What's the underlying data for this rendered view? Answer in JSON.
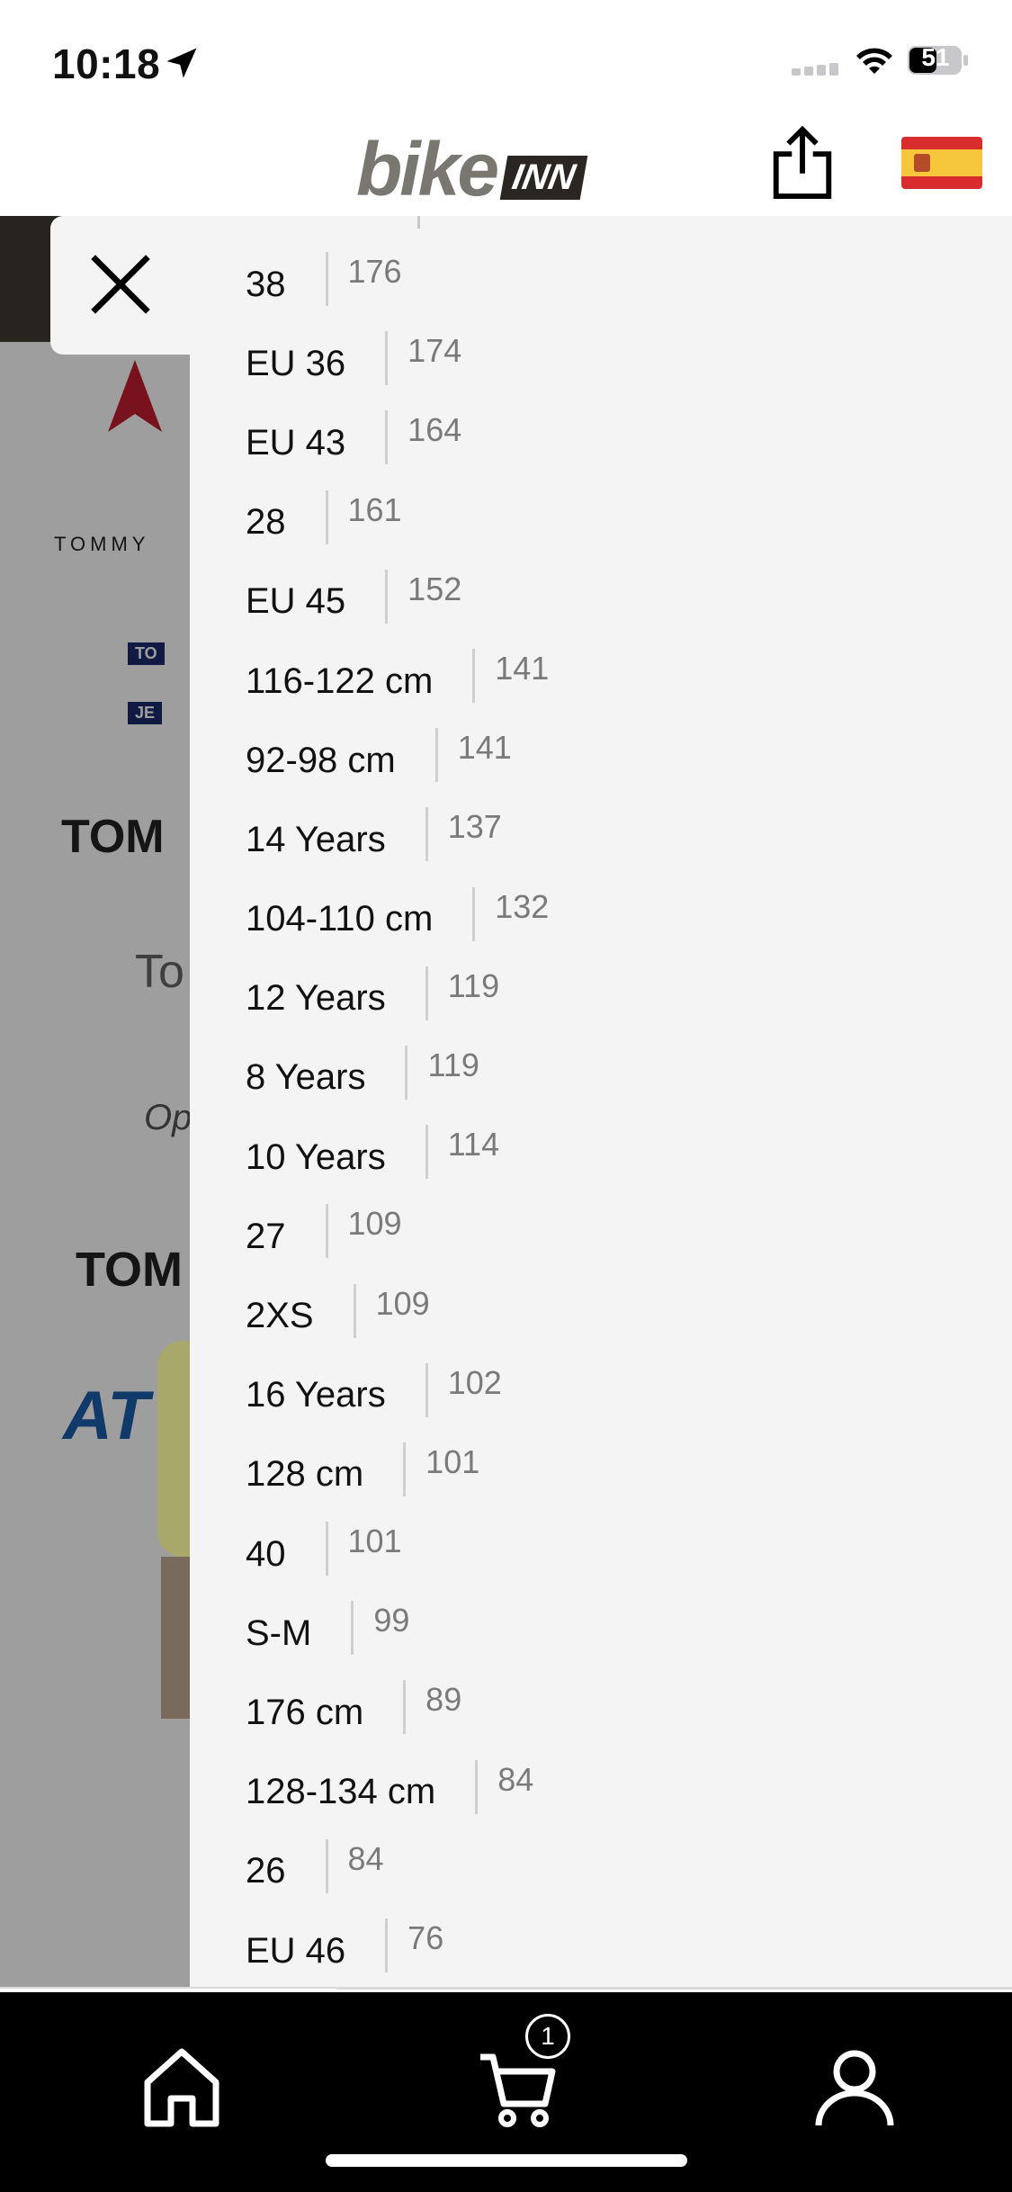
{
  "status_bar": {
    "time": "10:18",
    "battery": "51"
  },
  "header": {
    "logo_bike": "bike",
    "logo_inn": "INN",
    "flag_colors": {
      "red": "#d72d2d",
      "yellow": "#f6c63b"
    }
  },
  "background_brands": [
    "TOMMY",
    "TO",
    "JE",
    "TOM",
    "To",
    "Op",
    "TOM",
    "AT"
  ],
  "size_filter": {
    "items": [
      {
        "label": "38",
        "count": "176"
      },
      {
        "label": "EU 36",
        "count": "174"
      },
      {
        "label": "EU 43",
        "count": "164"
      },
      {
        "label": "28",
        "count": "161"
      },
      {
        "label": "EU 45",
        "count": "152"
      },
      {
        "label": "116-122 cm",
        "count": "141"
      },
      {
        "label": "92-98 cm",
        "count": "141"
      },
      {
        "label": "14 Years",
        "count": "137"
      },
      {
        "label": "104-110 cm",
        "count": "132"
      },
      {
        "label": "12 Years",
        "count": "119"
      },
      {
        "label": "8 Years",
        "count": "119"
      },
      {
        "label": "10 Years",
        "count": "114"
      },
      {
        "label": "27",
        "count": "109"
      },
      {
        "label": "2XS",
        "count": "109"
      },
      {
        "label": "16 Years",
        "count": "102"
      },
      {
        "label": "128 cm",
        "count": "101"
      },
      {
        "label": "40",
        "count": "101"
      },
      {
        "label": "S-M",
        "count": "99"
      },
      {
        "label": "176 cm",
        "count": "89"
      },
      {
        "label": "128-134 cm",
        "count": "84"
      },
      {
        "label": "26",
        "count": "84"
      },
      {
        "label": "EU 46",
        "count": "76"
      }
    ]
  },
  "tab_bar": {
    "tabs": [
      {
        "name": "home-icon"
      },
      {
        "name": "cart-icon"
      },
      {
        "name": "user-icon"
      }
    ],
    "cart_badge": "1"
  },
  "colors": {
    "panel_bg": "#f4f4f4",
    "tab_bar_bg": "#000000",
    "count_gray": "#7a7a7a"
  }
}
